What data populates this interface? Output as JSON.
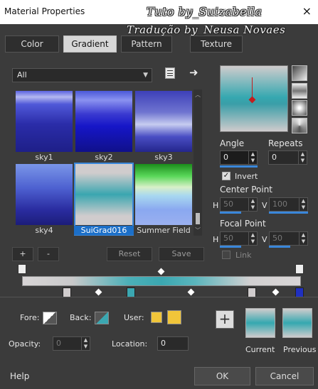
{
  "window": {
    "title": "Material Properties",
    "close_glyph": "×"
  },
  "watermark": {
    "line1": "Tuto by_Suizabella",
    "line2": "Tradução by_Neusa Novaes"
  },
  "tabs": [
    {
      "label": "Color"
    },
    {
      "label": "Gradient",
      "active": true
    },
    {
      "label": "Pattern"
    },
    {
      "label": "Texture"
    }
  ],
  "category": {
    "selected": "All"
  },
  "gradients": [
    {
      "label": "sky1"
    },
    {
      "label": "sky2"
    },
    {
      "label": "sky3"
    },
    {
      "label": "sky4"
    },
    {
      "label": "SuiGrad016",
      "selected": true
    },
    {
      "label": "Summer Field"
    }
  ],
  "list_buttons": {
    "add": "+",
    "remove": "-",
    "reset": "Reset",
    "save": "Save"
  },
  "settings": {
    "angle_label": "Angle",
    "angle_value": "0",
    "repeats_label": "Repeats",
    "repeats_value": "0",
    "invert_label": "Invert",
    "invert_checked": true,
    "center_label": "Center Point",
    "center_h_label": "H",
    "center_h": "50",
    "center_v_label": "V",
    "center_v": "100",
    "focal_label": "Focal Point",
    "focal_h_label": "H",
    "focal_h": "50",
    "focal_v_label": "V",
    "focal_v": "50",
    "link_label": "Link",
    "link_checked": false
  },
  "color_row": {
    "fore_label": "Fore:",
    "back_label": "Back:",
    "user_label": "User:",
    "user_color": "#f0c53a"
  },
  "opacity": {
    "label": "Opacity:",
    "value": "0"
  },
  "location": {
    "label": "Location:",
    "value": "0"
  },
  "previews": {
    "add": "+",
    "current": "Current",
    "previous": "Previous"
  },
  "footer": {
    "help": "Help",
    "ok": "OK",
    "cancel": "Cancel"
  },
  "colors": {
    "accent": "#3a87da",
    "teal": "#3ba7b1",
    "grey": "#d0cccd"
  }
}
